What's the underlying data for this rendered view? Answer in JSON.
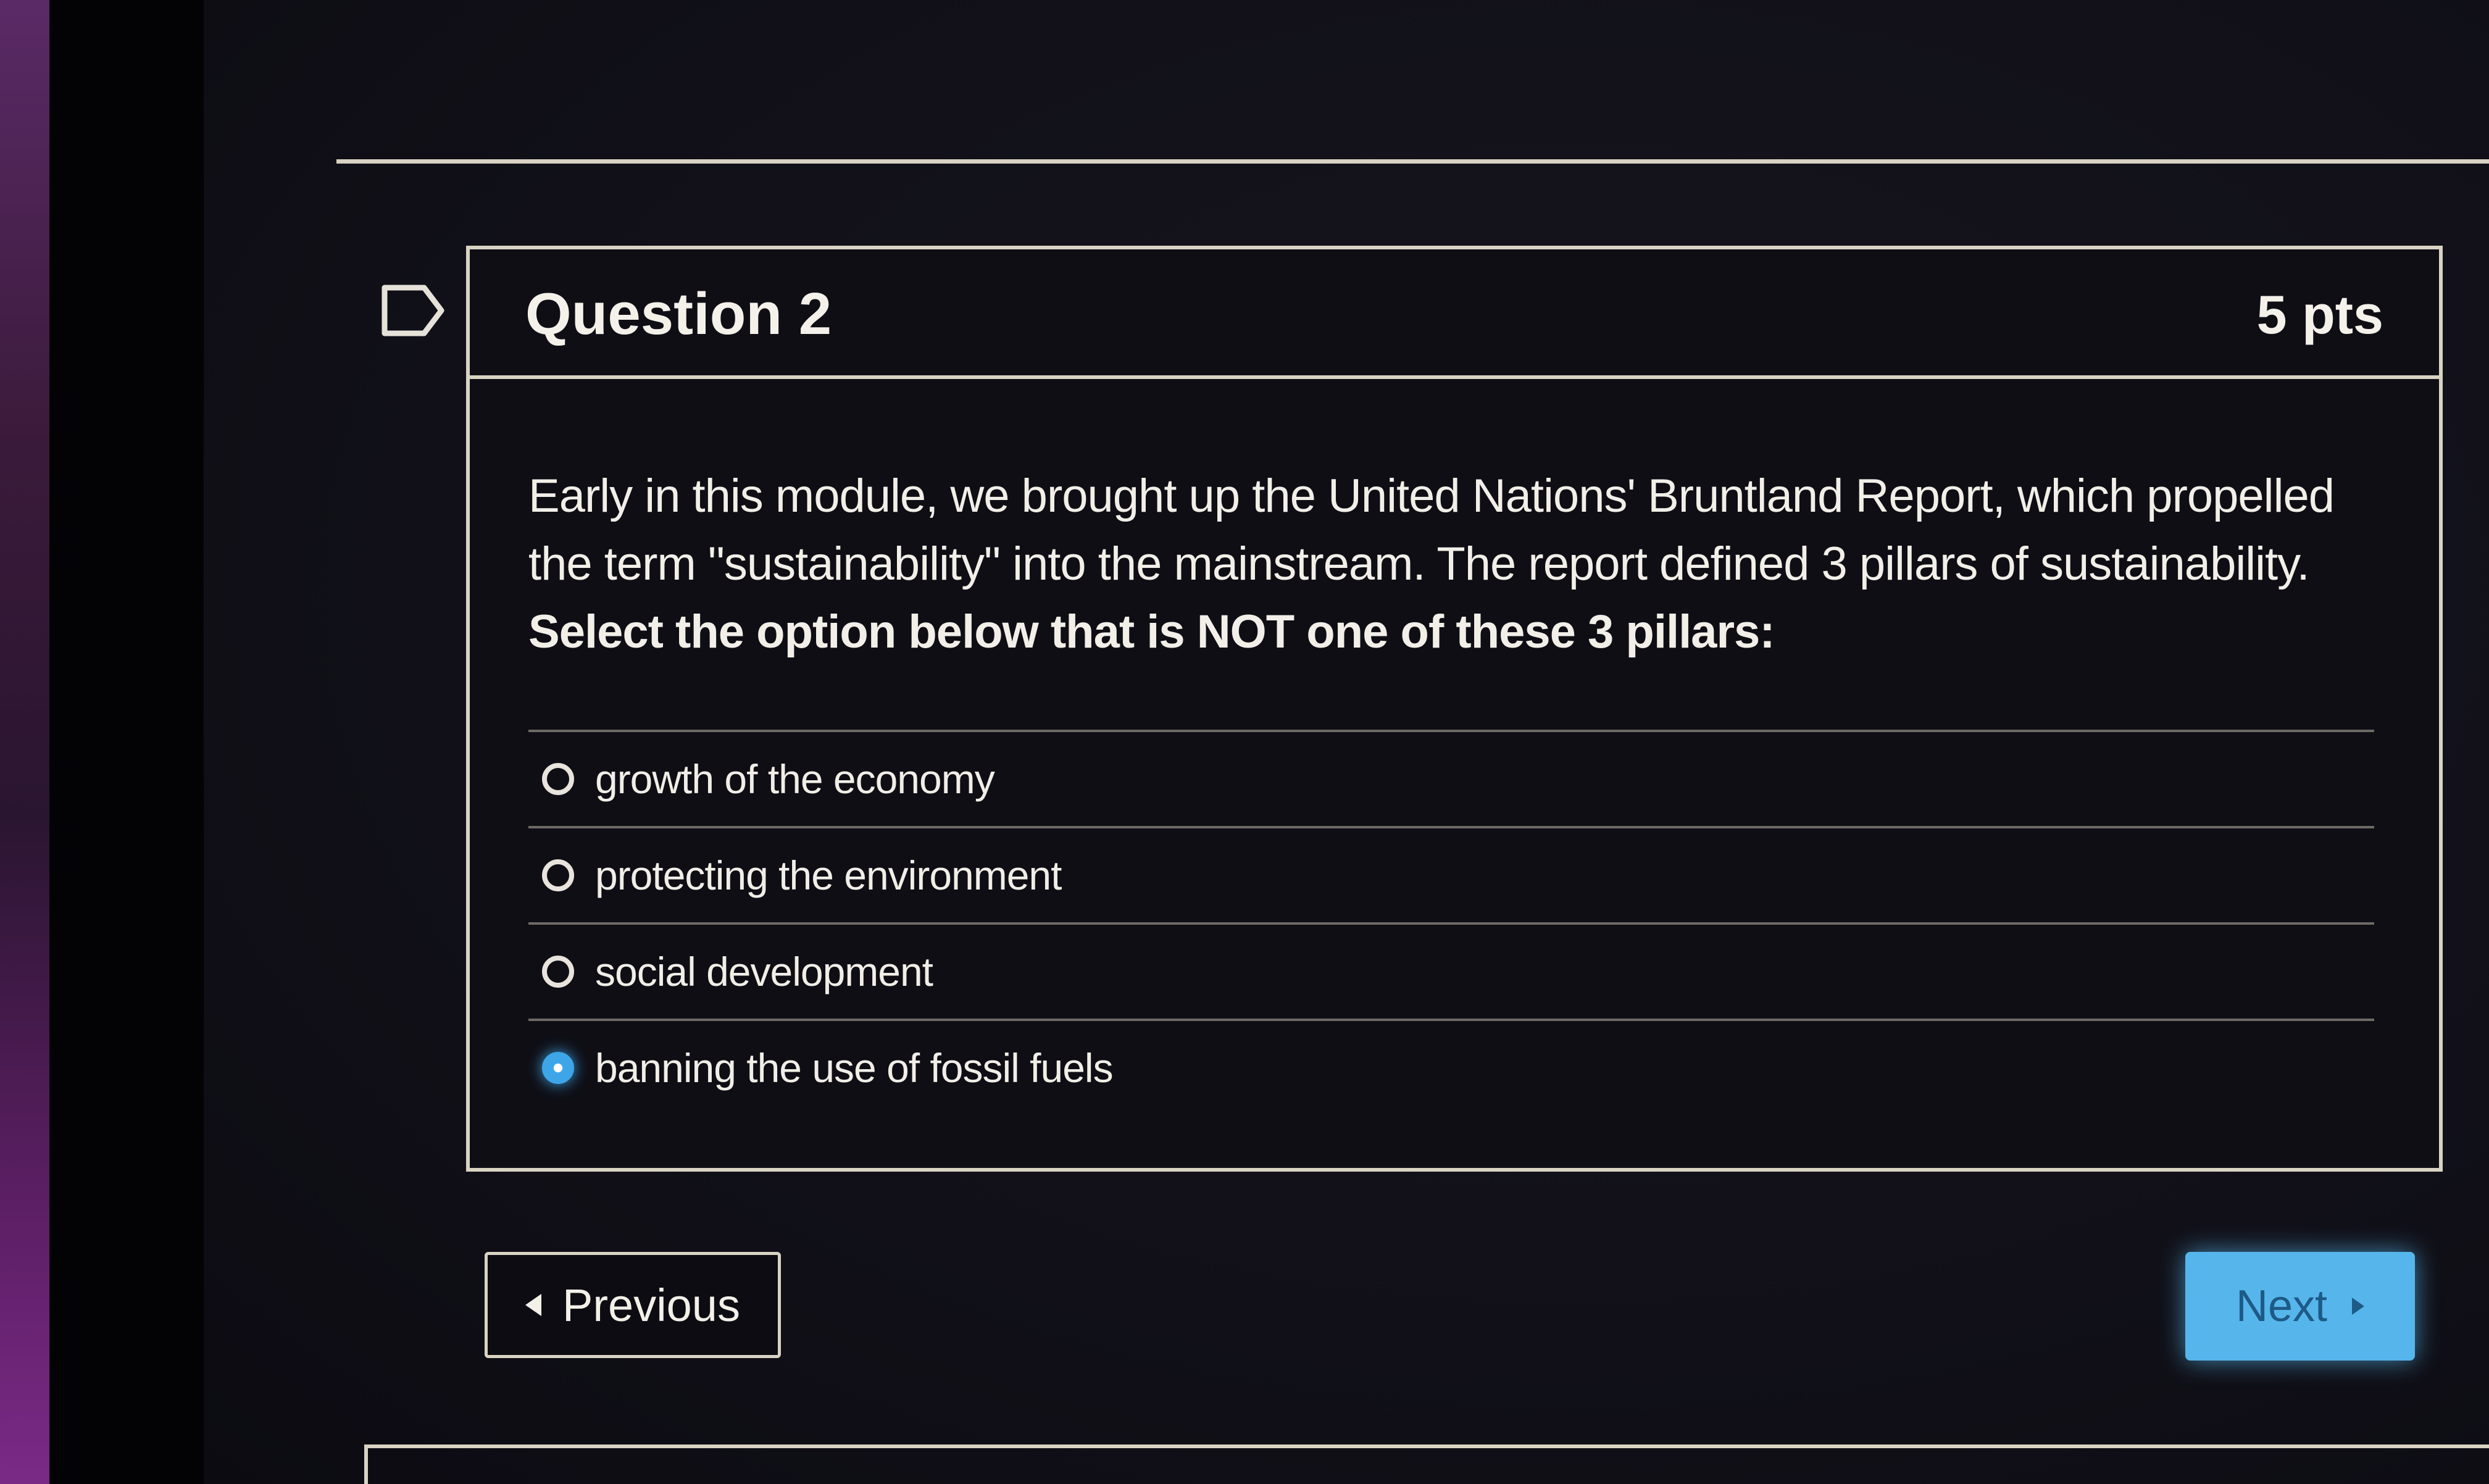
{
  "question": {
    "title": "Question 2",
    "points": "5 pts",
    "text_normal": "Early in this module, we brought up the United Nations' Bruntland Report, which propelled the term \"sustainability\" into the mainstream. The report defined 3 pillars of sustainability. ",
    "text_bold": "Select the option below that is NOT one of these 3 pillars:",
    "flag_icon": "flag-outline-icon"
  },
  "answers": [
    {
      "label": "growth of the economy",
      "selected": false
    },
    {
      "label": "protecting the environment",
      "selected": false
    },
    {
      "label": "social development",
      "selected": false
    },
    {
      "label": "banning the use of fossil fuels",
      "selected": true
    }
  ],
  "navigation": {
    "previous_label": "Previous",
    "next_label": "Next"
  },
  "colors": {
    "accent": "#3ea6e8",
    "next_button": "#56b6ec",
    "border": "#d9d3c3"
  }
}
